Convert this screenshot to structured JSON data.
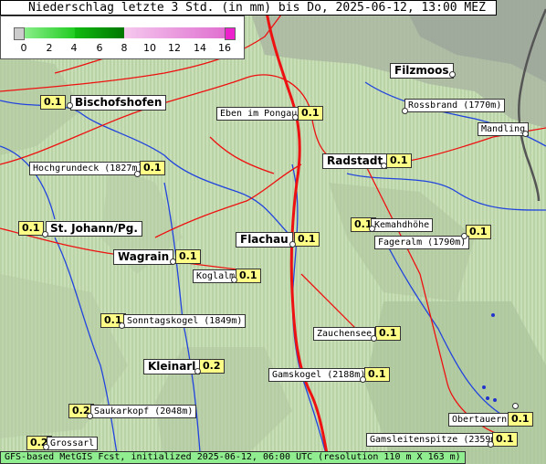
{
  "title": "Niederschlag letzte 3 Std. (in mm) bis Do, 2025-06-12, 13:00 MEZ",
  "legend": {
    "ticks": [
      "0",
      "2",
      "4",
      "6",
      "8",
      "10",
      "12",
      "14",
      "16"
    ],
    "colors": {
      "trace": "#cccccc",
      "light": "#66dd66",
      "mid": "#00bb00",
      "heavy": "#008800",
      "pink": "#ee99dd",
      "magenta": "#ee22cc"
    }
  },
  "places": [
    {
      "id": "filzmoos",
      "name": "Filzmoos",
      "value": ""
    },
    {
      "id": "bischofshofen",
      "name": "Bischofshofen",
      "value": "0.1"
    },
    {
      "id": "eben",
      "name": "Eben im Pongau",
      "value": "0.1"
    },
    {
      "id": "rossbrand",
      "name": "Rossbrand (1770m)",
      "value": ""
    },
    {
      "id": "mandling",
      "name": "Mandling",
      "value": ""
    },
    {
      "id": "radstadt",
      "name": "Radstadt",
      "value": "0.1"
    },
    {
      "id": "hochgrundeck",
      "name": "Hochgrundeck (1827m)",
      "value": "0.1"
    },
    {
      "id": "stjohann",
      "name": "St. Johann/Pg.",
      "value": "0.1"
    },
    {
      "id": "kemahdhoehe",
      "name": "Kemahdhöhe",
      "value": "0.1"
    },
    {
      "id": "fageralm",
      "name": "Fageralm (1790m)",
      "value": "0.1"
    },
    {
      "id": "flachau",
      "name": "Flachau",
      "value": "0.1"
    },
    {
      "id": "wagrain",
      "name": "Wagrain",
      "value": "0.1"
    },
    {
      "id": "koglalm",
      "name": "Koglalm",
      "value": "0.1"
    },
    {
      "id": "sonntagskogel",
      "name": "Sonntagskogel (1849m)",
      "value": "0.1"
    },
    {
      "id": "zauchensee",
      "name": "Zauchensee",
      "value": "0.1"
    },
    {
      "id": "kleinarl",
      "name": "Kleinarl",
      "value": "0.2"
    },
    {
      "id": "gamskogel",
      "name": "Gamskogel (2188m)",
      "value": "0.1"
    },
    {
      "id": "saukarkopf",
      "name": "Saukarkopf (2048m)",
      "value": "0.2"
    },
    {
      "id": "obertauern",
      "name": "Obertauern",
      "value": "0.1"
    },
    {
      "id": "grossarl",
      "name": "Grossarl",
      "value": "0.2"
    },
    {
      "id": "gamsleitenspitze",
      "name": "Gamsleitenspitze (2359m)",
      "value": "0.1"
    }
  ],
  "footer": "GFS-based MetGIS Fcst, initialized 2025-06-12, 06:00 UTC  (resolution 110 m X 163 m)"
}
